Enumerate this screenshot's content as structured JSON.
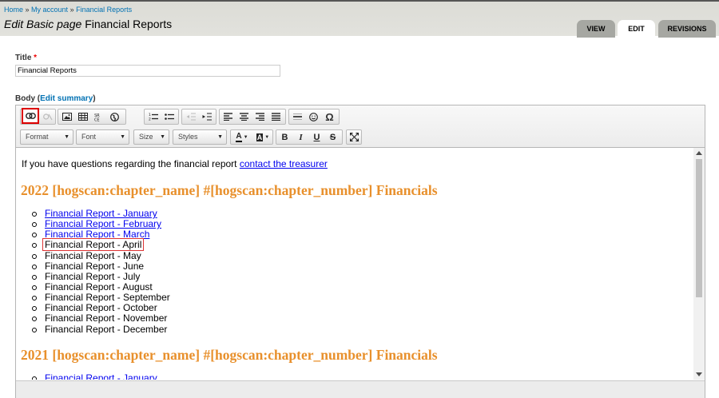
{
  "breadcrumb": {
    "items": [
      "Home",
      "My account",
      "Financial Reports"
    ],
    "separator": " » "
  },
  "page_title": {
    "prefix": "Edit Basic page",
    "name": "Financial Reports"
  },
  "tabs": [
    {
      "label": "VIEW",
      "active": false
    },
    {
      "label": "EDIT",
      "active": true
    },
    {
      "label": "REVISIONS",
      "active": false
    }
  ],
  "form": {
    "title_label": "Title",
    "required_mark": "*",
    "title_value": "Financial Reports",
    "body_label": "Body",
    "edit_summary": "Edit summary",
    "paren_open": "(",
    "paren_close": ")"
  },
  "toolbar": {
    "row1": [
      "link-icon",
      "unlink-icon",
      "image-icon",
      "table-icon",
      "source-icon",
      "globe-icon",
      "numbered-list-icon",
      "bulleted-list-icon",
      "outdent-icon",
      "indent-icon",
      "align-left-icon",
      "align-center-icon",
      "align-right-icon",
      "justify-icon",
      "horizontal-rule-icon",
      "smiley-icon",
      "omega-icon"
    ],
    "combos": [
      "Format",
      "Font",
      "Size",
      "Styles"
    ],
    "format_buttons": [
      "B",
      "I",
      "U",
      "S"
    ]
  },
  "content": {
    "intro_text": "If you have questions regarding the financial report ",
    "intro_link": "contact the treasurer",
    "sections": [
      {
        "heading": "2022 [hogscan:chapter_name] #[hogscan:chapter_number] Financials",
        "items": [
          {
            "label": "Financial Report - January",
            "link": true
          },
          {
            "label": "Financial Report - February",
            "link": true
          },
          {
            "label": "Financial Report - March",
            "link": true
          },
          {
            "label": "Financial Report - April",
            "link": false,
            "selected": true
          },
          {
            "label": "Financial Report - May",
            "link": false
          },
          {
            "label": "Financial Report - June",
            "link": false
          },
          {
            "label": "Financial Report - July",
            "link": false
          },
          {
            "label": "Financial Report - August",
            "link": false
          },
          {
            "label": "Financial Report - September",
            "link": false
          },
          {
            "label": "Financial Report - October",
            "link": false
          },
          {
            "label": "Financial Report - November",
            "link": false
          },
          {
            "label": "Financial Report - December",
            "link": false
          }
        ]
      },
      {
        "heading": "2021 [hogscan:chapter_name] #[hogscan:chapter_number] Financials",
        "items": [
          {
            "label": "Financial Report - January",
            "link": true
          }
        ]
      }
    ]
  },
  "colors": {
    "link": "#0071b3",
    "heading": "#e8902c",
    "highlight_border": "#dd0000"
  }
}
